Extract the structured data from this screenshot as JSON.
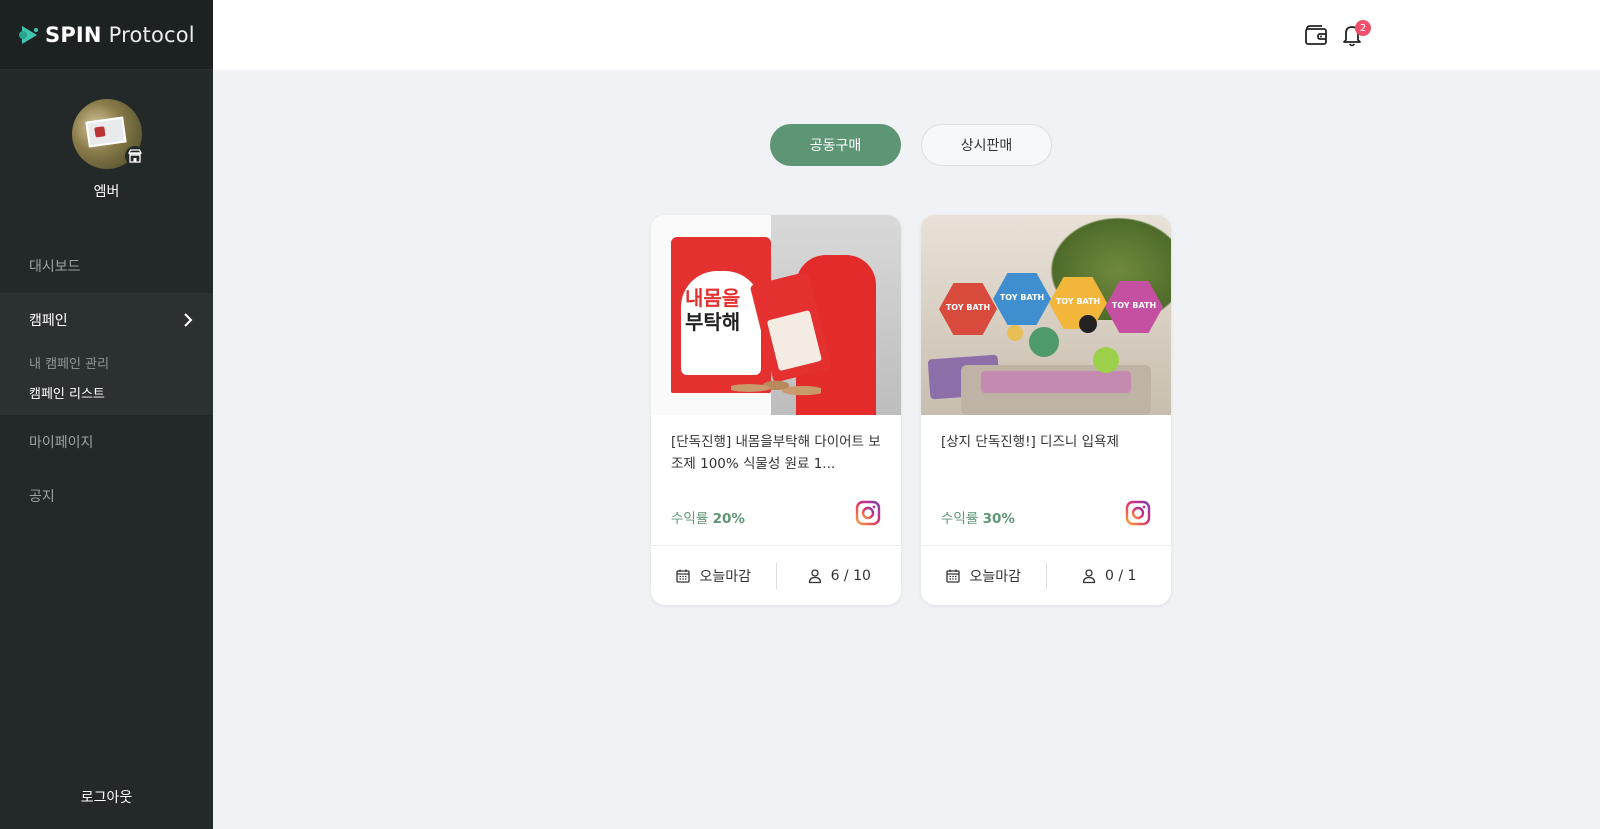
{
  "brand": {
    "bold": "SPIN",
    "light": "Protocol"
  },
  "profile": {
    "name": "엠버"
  },
  "nav": {
    "dashboard": "대시보드",
    "campaign": "캠페인",
    "campaign_sub": [
      "내 캠페인 관리",
      "캠페인 리스트"
    ],
    "mypage": "마이페이지",
    "notice": "공지",
    "logout": "로그아웃"
  },
  "topbar": {
    "notification_count": "2"
  },
  "tabs": {
    "group_buy": "공동구매",
    "always_sale": "상시판매",
    "active": "공동구매"
  },
  "cards": [
    {
      "title": "[단독진행] 내몸을부탁해 다이어트 보조제 100% 식물성 원료 1...",
      "profit_label": "수익률",
      "profit_value": "20%",
      "deadline": "오늘마감",
      "participants": "6 / 10",
      "image_text": {
        "line1": "내몸을",
        "line2": "부탁해"
      },
      "channel_icon": "instagram-icon"
    },
    {
      "title": "[상지 단독진행!] 디즈니 입욕제",
      "profit_label": "수익률",
      "profit_value": "30%",
      "deadline": "오늘마감",
      "participants": "0 / 1",
      "image_text": {
        "tag": "TOY BATH"
      },
      "channel_icon": "instagram-icon"
    }
  ],
  "colors": {
    "accent": "#5e9675",
    "sidebar": "#232929",
    "badge": "#ef4f6b",
    "brand_logo": "#3fc6b0"
  }
}
